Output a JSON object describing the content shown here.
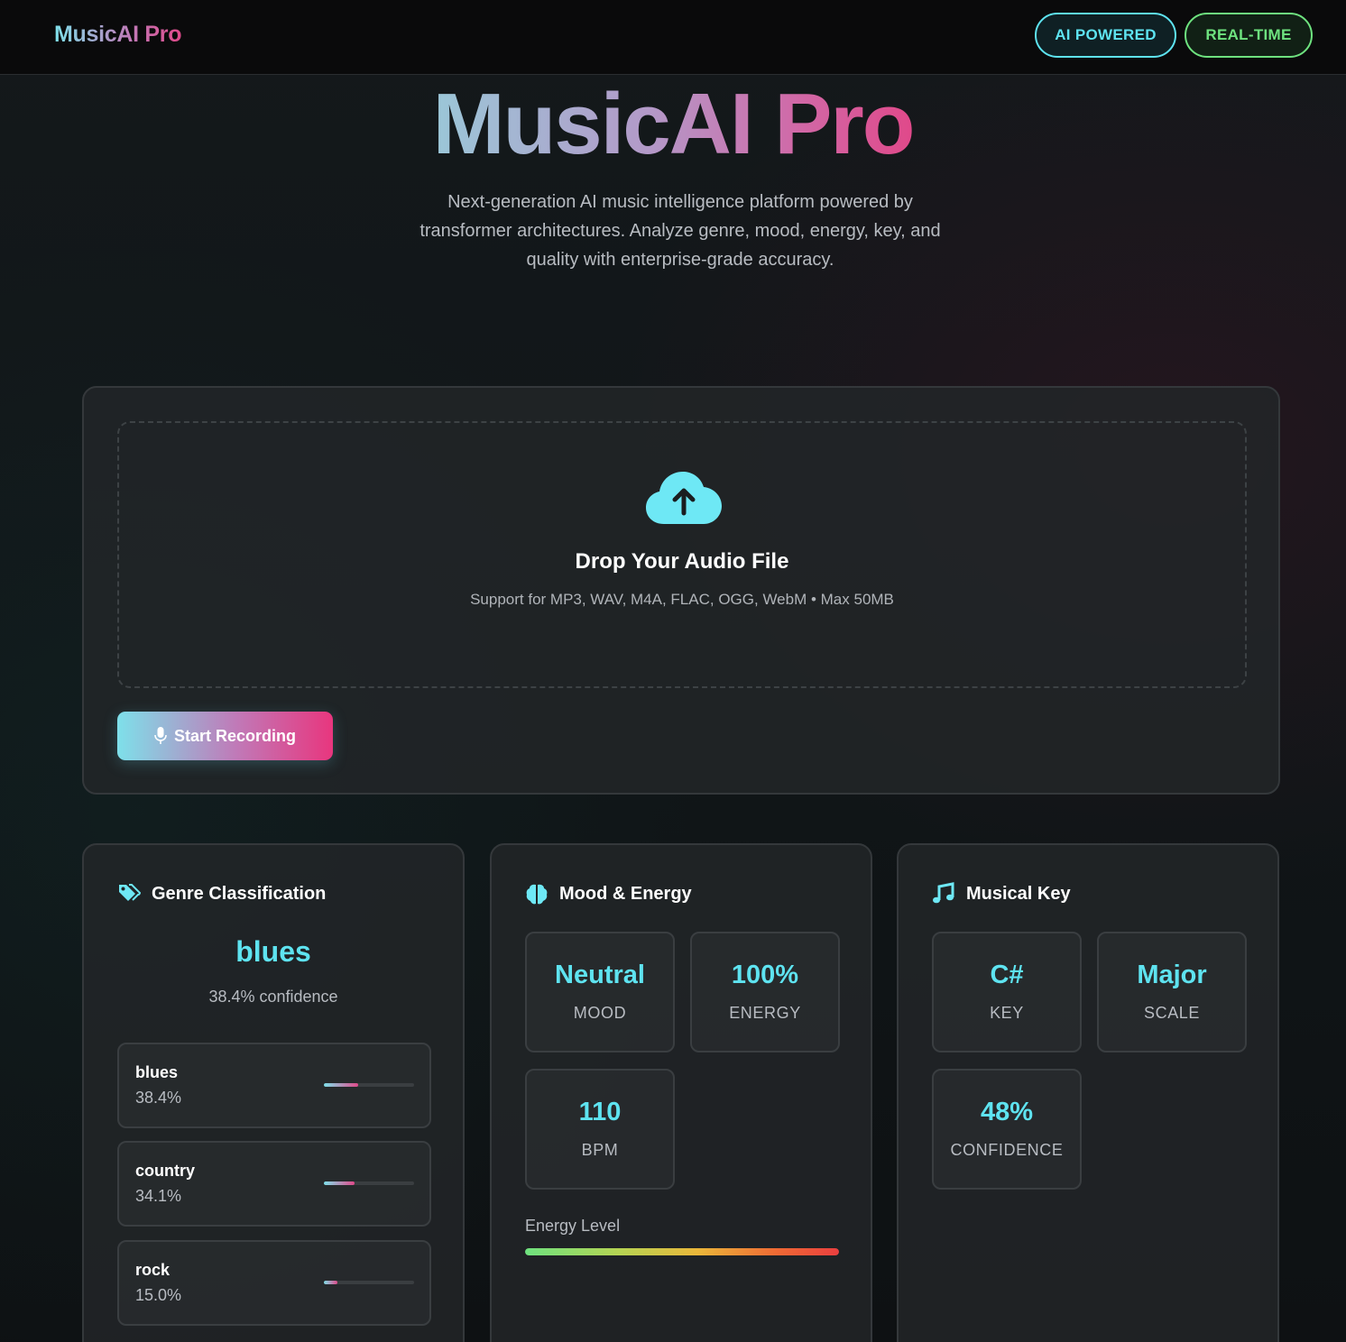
{
  "topbar": {
    "brand": "MusicAI Pro",
    "badges": [
      "AI POWERED",
      "REAL-TIME"
    ]
  },
  "hero": {
    "title": "MusicAI Pro",
    "subtitle": "Next-generation AI music intelligence platform powered by transformer architectures. Analyze genre, mood, energy, key, and quality with enterprise-grade accuracy."
  },
  "upload": {
    "title": "Drop Your Audio File",
    "subtitle": "Support for MP3, WAV, M4A, FLAC, OGG, WebM • Max 50MB",
    "record_label": "Start Recording"
  },
  "genre": {
    "heading": "Genre Classification",
    "top": "blues",
    "confidence": "38.4% confidence",
    "items": [
      {
        "name": "blues",
        "pct": "38.4%",
        "value": 0.384
      },
      {
        "name": "country",
        "pct": "34.1%",
        "value": 0.341
      },
      {
        "name": "rock",
        "pct": "15.0%",
        "value": 0.15
      }
    ]
  },
  "mood": {
    "heading": "Mood & Energy",
    "stats": [
      {
        "value": "Neutral",
        "label": "MOOD"
      },
      {
        "value": "100%",
        "label": "ENERGY"
      },
      {
        "value": "110",
        "label": "BPM"
      }
    ],
    "energy_label": "Energy Level",
    "energy_level": 1.0
  },
  "key": {
    "heading": "Musical Key",
    "stats": [
      {
        "value": "C#",
        "label": "KEY"
      },
      {
        "value": "Major",
        "label": "SCALE"
      },
      {
        "value": "48%",
        "label": "CONFIDENCE"
      }
    ]
  },
  "colors": {
    "accent_cyan": "#5ee3f0",
    "accent_green": "#6ee27f",
    "accent_pink": "#e0498a"
  },
  "icons": {
    "upload": "cloud-upload-icon",
    "record": "microphone-icon",
    "genre": "tags-icon",
    "mood": "brain-icon",
    "key": "music-note-icon"
  }
}
